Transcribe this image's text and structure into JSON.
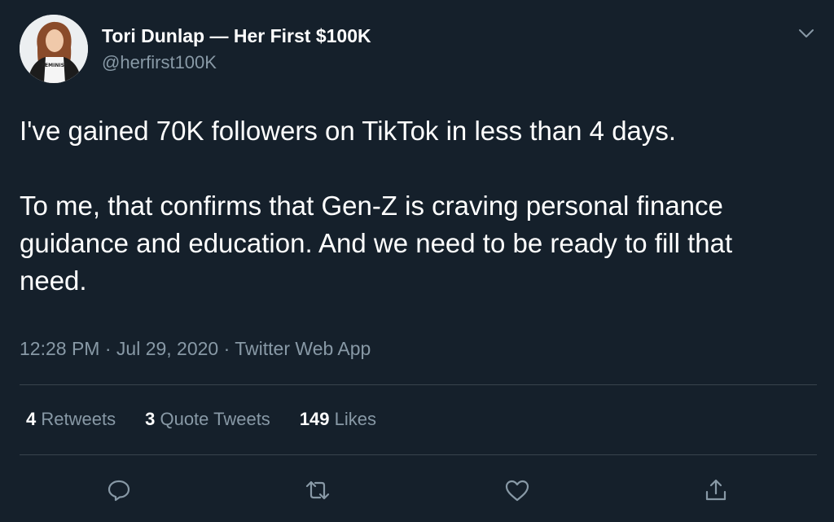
{
  "user": {
    "display_name": "Tori Dunlap — Her First $100K",
    "handle": "@herfirst100K",
    "shirt_text": "FEMINIST"
  },
  "tweet": {
    "paragraph_1": "I've gained 70K followers on TikTok in less than 4 days.",
    "paragraph_2": "To me, that confirms that Gen-Z is craving personal finance guidance and education. And we need to be ready to fill that need.",
    "time": "12:28 PM",
    "separator": "·",
    "date": "Jul 29, 2020",
    "source": "Twitter Web App"
  },
  "stats": {
    "retweets_count": "4",
    "retweets_label": "Retweets",
    "quotes_count": "3",
    "quotes_label": "Quote Tweets",
    "likes_count": "149",
    "likes_label": "Likes"
  },
  "icons": {
    "menu": "chevron-down-icon",
    "reply": "reply-icon",
    "retweet": "retweet-icon",
    "like": "heart-icon",
    "share": "share-icon"
  },
  "colors": {
    "background": "#15202b",
    "primary_text": "#ffffff",
    "secondary_text": "#8899a6",
    "divider": "#38444d"
  }
}
